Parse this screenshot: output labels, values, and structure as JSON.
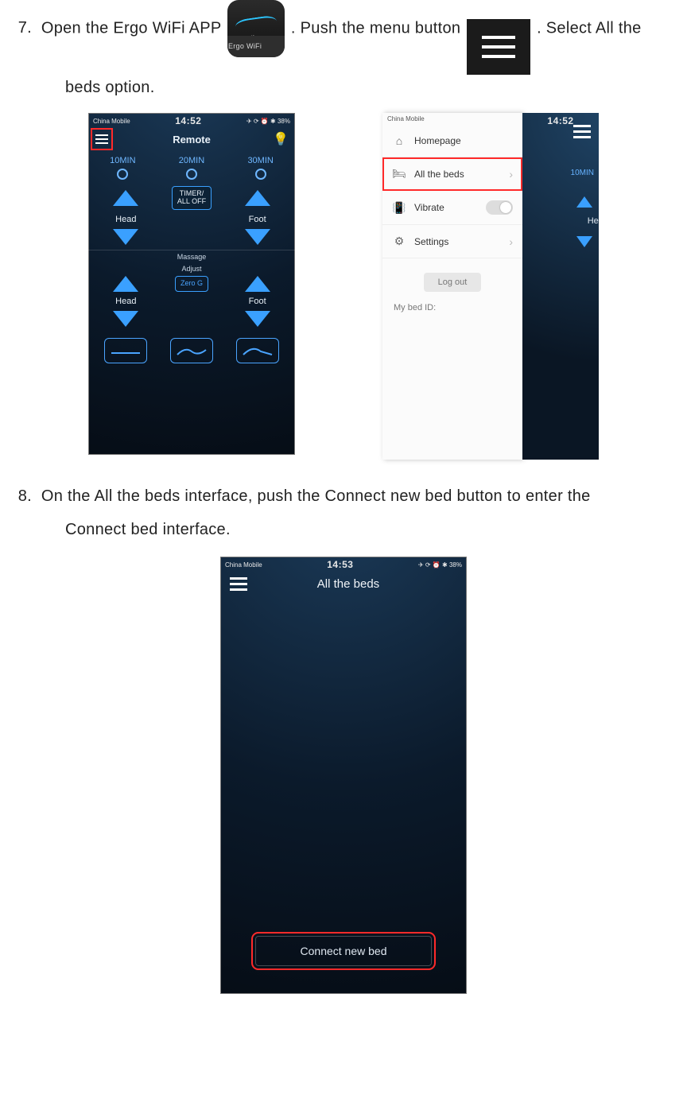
{
  "step7": {
    "number": "7.",
    "text_a": "Open the Ergo WiFi APP",
    "text_b": ". Push the menu button",
    "text_c": ". Select All the",
    "text_d": "beds option."
  },
  "ergo_icon": {
    "brand": "ergomotion",
    "caption": "Ergo WiFi"
  },
  "status": {
    "carrier": "China Mobile",
    "time_a": "14:52",
    "time_c": "14:53",
    "right": "✈ ⟳ ⏰ ✱ 38%"
  },
  "remote": {
    "title": "Remote",
    "timers": [
      "10MIN",
      "20MIN",
      "30MIN"
    ],
    "timer_off": "TIMER/\nALL OFF",
    "head": "Head",
    "foot": "Foot",
    "massage": "Massage",
    "adjust": "Adjust",
    "zero_g": "Zero G"
  },
  "menu": {
    "homepage": "Homepage",
    "all_beds": "All the beds",
    "vibrate": "Vibrate",
    "settings": "Settings",
    "logout": "Log out",
    "my_bed": "My bed ID:"
  },
  "peek": {
    "t10": "10MIN",
    "head": "Head"
  },
  "step8": {
    "number": "8.",
    "text_a": "On the All the beds interface, push the Connect new bed button to enter the",
    "text_b": "Connect bed interface."
  },
  "all_beds": {
    "title": "All the beds",
    "connect": "Connect new bed"
  }
}
